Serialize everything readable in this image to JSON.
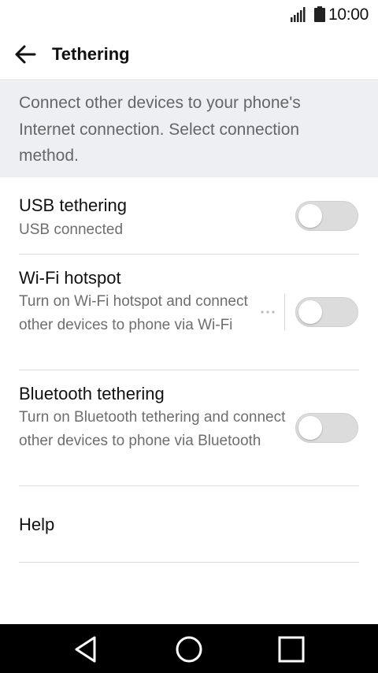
{
  "status_bar": {
    "time": "10:00",
    "icons": [
      "signal-icon",
      "battery-icon"
    ]
  },
  "app_bar": {
    "title": "Tethering",
    "back_icon": "arrow-left-icon"
  },
  "description": "Connect other devices to your phone's Internet connection. Select connection method.",
  "settings": [
    {
      "title": "USB tethering",
      "subtitle": "USB connected",
      "enabled": false
    },
    {
      "title": "Wi-Fi hotspot",
      "subtitle": "Turn on Wi-Fi hotspot and connect other devices to phone via Wi-Fi",
      "enabled": false,
      "has_more": true,
      "more_icon": "more-horizontal-icon"
    },
    {
      "title": "Bluetooth tethering",
      "subtitle": "Turn on Bluetooth tethering and connect other devices to phone via Bluetooth",
      "enabled": false
    },
    {
      "title": "Help"
    }
  ],
  "nav_bar": {
    "buttons": [
      "back-triangle-icon",
      "home-circle-icon",
      "recents-square-icon"
    ]
  },
  "colors": {
    "description_bg": "#eeeff3",
    "toggle_off": "#dcdcdc",
    "nav_bg": "#000000"
  }
}
